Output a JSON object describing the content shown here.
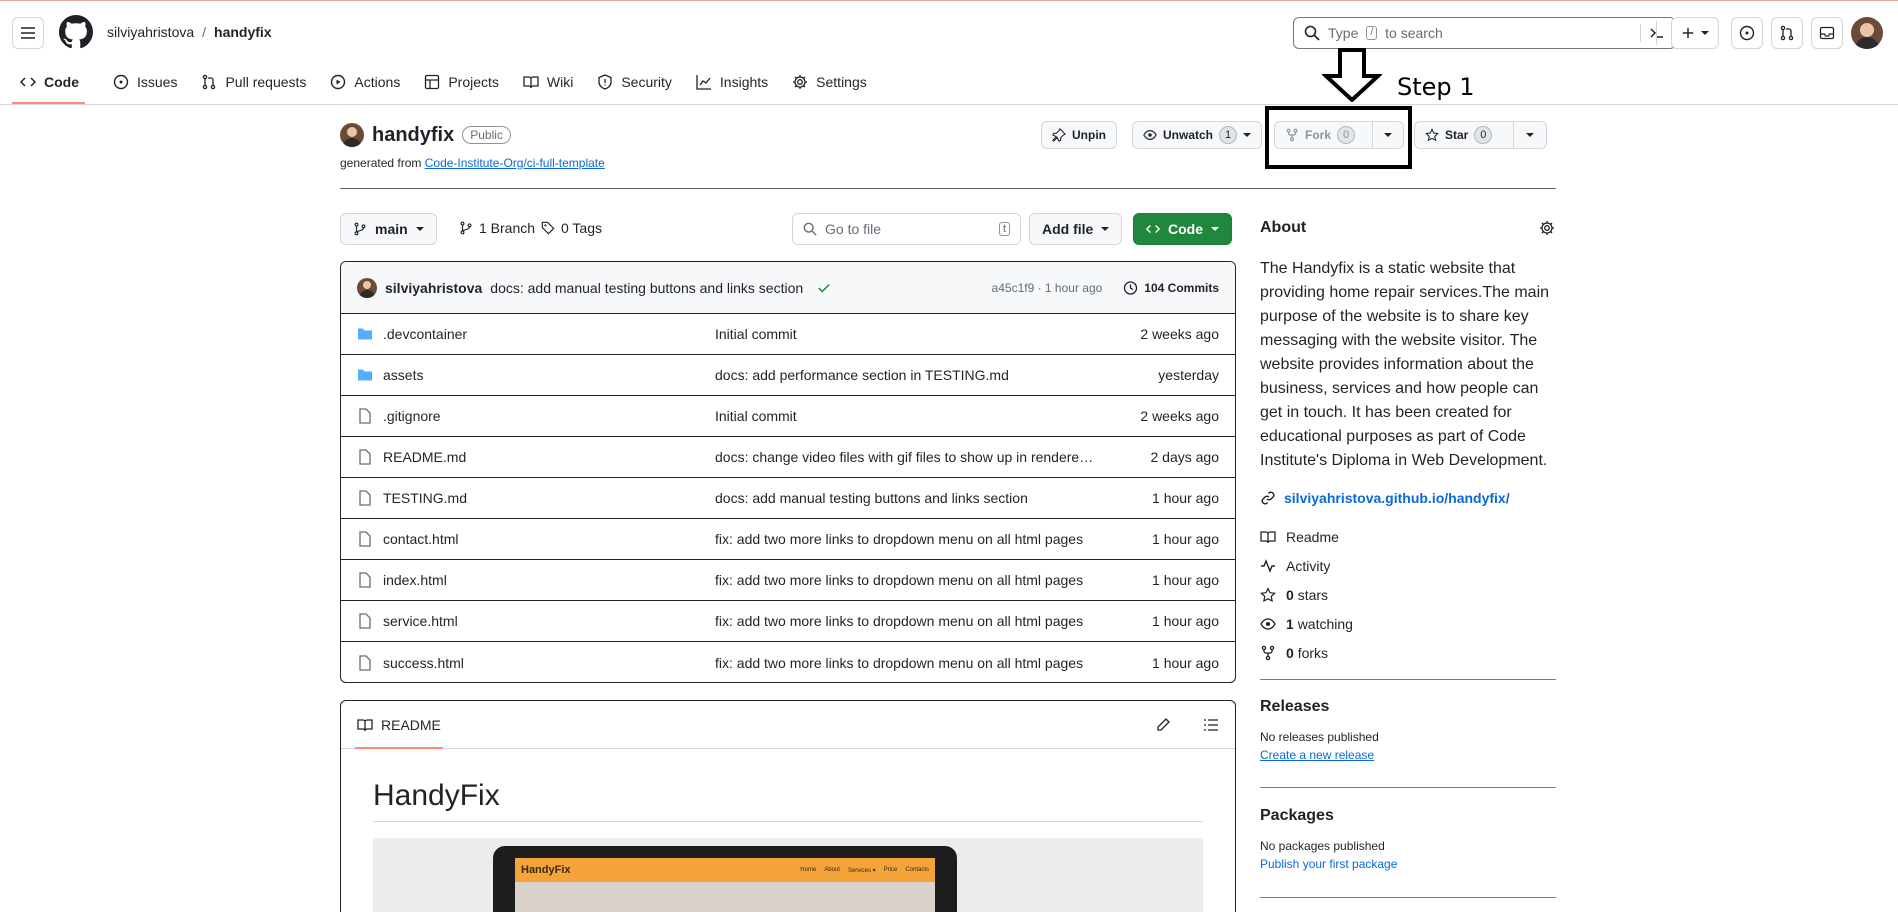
{
  "header": {
    "owner": "silviyahristova",
    "separator": "/",
    "repo": "handyfix",
    "search_placeholder_pre": "Type",
    "search_key": "/",
    "search_placeholder_post": "to search"
  },
  "tabs": [
    {
      "label": "Code",
      "icon": "code-icon"
    },
    {
      "label": "Issues",
      "icon": "issue-icon"
    },
    {
      "label": "Pull requests",
      "icon": "pull-request-icon"
    },
    {
      "label": "Actions",
      "icon": "play-icon"
    },
    {
      "label": "Projects",
      "icon": "table-icon"
    },
    {
      "label": "Wiki",
      "icon": "book-icon"
    },
    {
      "label": "Security",
      "icon": "shield-icon"
    },
    {
      "label": "Insights",
      "icon": "graph-icon"
    },
    {
      "label": "Settings",
      "icon": "gear-icon"
    }
  ],
  "repo": {
    "name": "handyfix",
    "visibility": "Public",
    "generated_from_label": "generated from",
    "template": "Code-Institute-Org/ci-full-template"
  },
  "actions": {
    "unpin": "Unpin",
    "unwatch": "Unwatch",
    "watch_count": "1",
    "fork": "Fork",
    "fork_count": "0",
    "star": "Star",
    "star_count": "0"
  },
  "annotation": {
    "step": "Step 1"
  },
  "filenav": {
    "branch": "main",
    "branches": "1 Branch",
    "tags": "0 Tags",
    "goto_placeholder": "Go to file",
    "goto_key": "t",
    "add_file": "Add file",
    "code": "Code"
  },
  "commit": {
    "author": "silviyahristova",
    "message": "docs: add manual testing buttons and links section",
    "hash_time": "a45c1f9 · 1 hour ago",
    "commits": "104 Commits"
  },
  "files": [
    {
      "type": "folder",
      "name": ".devcontainer",
      "message": "Initial commit",
      "date": "2 weeks ago"
    },
    {
      "type": "folder",
      "name": "assets",
      "message": "docs: add performance section in TESTING.md",
      "date": "yesterday"
    },
    {
      "type": "file",
      "name": ".gitignore",
      "message": "Initial commit",
      "date": "2 weeks ago"
    },
    {
      "type": "file",
      "name": "README.md",
      "message": "docs: change video files with gif files to show up in rendered…",
      "date": "2 days ago"
    },
    {
      "type": "file",
      "name": "TESTING.md",
      "message": "docs: add manual testing buttons and links section",
      "date": "1 hour ago"
    },
    {
      "type": "file",
      "name": "contact.html",
      "message": "fix: add two more links to dropdown menu on all html pages",
      "date": "1 hour ago"
    },
    {
      "type": "file",
      "name": "index.html",
      "message": "fix: add two more links to dropdown menu on all html pages",
      "date": "1 hour ago"
    },
    {
      "type": "file",
      "name": "service.html",
      "message": "fix: add two more links to dropdown menu on all html pages",
      "date": "1 hour ago"
    },
    {
      "type": "file",
      "name": "success.html",
      "message": "fix: add two more links to dropdown menu on all html pages",
      "date": "1 hour ago"
    }
  ],
  "readme": {
    "tab": "README",
    "heading": "HandyFix",
    "preview_logo": "HandyFix",
    "preview_nav": [
      "Home",
      "About",
      "Services ▾",
      "Price",
      "Contacts"
    ]
  },
  "about": {
    "title": "About",
    "description": "The Handyfix is a static website that providing home repair services.The main purpose of the website is to share key messaging with the website visitor. The website provides information about the business, services and how people can get in touch. It has been created for educational purposes as part of Code Institute's Diploma in Web Development.",
    "link": "silviyahristova.github.io/handyfix/",
    "readme": "Readme",
    "activity": "Activity",
    "stars_num": "0",
    "stars": "stars",
    "watching_num": "1",
    "watching": "watching",
    "forks_num": "0",
    "forks": "forks"
  },
  "releases": {
    "title": "Releases",
    "none": "No releases published",
    "create": "Create a new release"
  },
  "packages": {
    "title": "Packages",
    "none": "No packages published",
    "publish": "Publish your first package"
  }
}
